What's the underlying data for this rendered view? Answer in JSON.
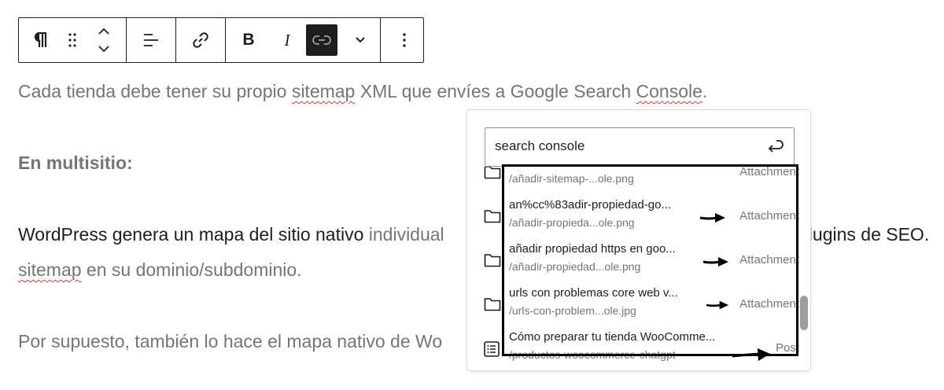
{
  "toolbar": {
    "paragraph_icon": "paragraph-icon",
    "drag_icon": "drag-handle-icon",
    "move_icon": "move-up-down-icon",
    "align_icon": "align-left-icon",
    "link_icon": "link-icon",
    "bold_label": "B",
    "italic_label": "I",
    "unlink_icon": "link-active-icon",
    "more_format_icon": "chevron-down-icon",
    "options_icon": "more-vertical-icon"
  },
  "content": {
    "line1_a": "Cada tienda debe tener su propio ",
    "line1_b": "sitemap",
    "line1_c": " XML que envíes a Google Search ",
    "line1_d": "Console",
    "line1_e": ".",
    "heading": "En multisitio:",
    "line3_a": "WordPress genera un mapa del sitio nativo",
    "line3_b": " individual",
    "line3_c": "plugins de SEO.",
    "line4_a": "sitemap",
    "line4_b": " en su dominio/subdominio.",
    "line5": "Por supuesto, también lo hace el mapa nativo de Wo"
  },
  "link_popover": {
    "search_value": "search console",
    "submit_icon": "enter-icon",
    "results": [
      {
        "title": "",
        "url": "/añadir-sitemap-...ole.png",
        "kind": "Attachment",
        "icon": "folder-icon"
      },
      {
        "title": "an%cc%83adir-propiedad-go...",
        "url": "/añadir-propieda...ole.png",
        "kind": "Attachment",
        "icon": "folder-icon"
      },
      {
        "title": "añadir propiedad https en goo...",
        "url": "/añadir-propiedad...ole.png",
        "kind": "Attachment",
        "icon": "folder-icon"
      },
      {
        "title": "urls con problemas core web v...",
        "url": "/urls-con-problem...ole.jpg",
        "kind": "Attachment",
        "icon": "folder-icon"
      },
      {
        "title": "Cómo preparar tu tienda WooComme...",
        "url": "/productos-woocommerce-chatgpt",
        "kind": "Post",
        "icon": "post-list-icon"
      }
    ]
  },
  "colors": {
    "text_dark": "#1e1e1e",
    "text_muted": "#757575",
    "spell_underline": "#d63638",
    "annotation": "#000000"
  }
}
